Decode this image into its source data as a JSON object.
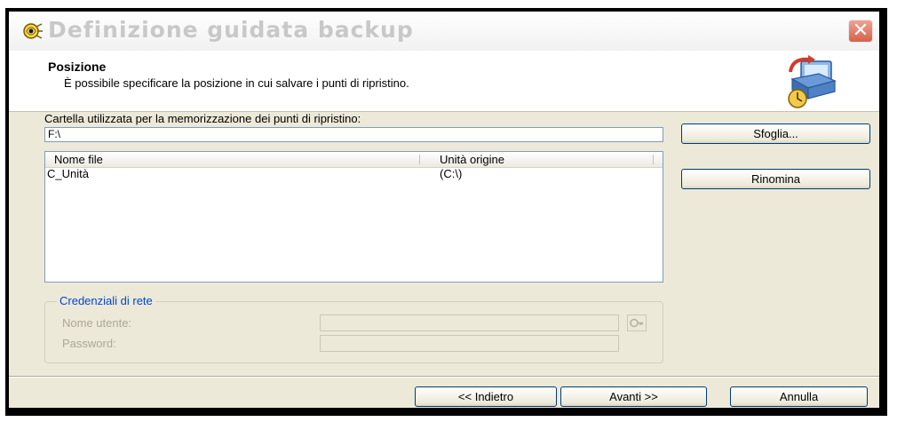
{
  "window": {
    "title": "Definizione guidata backup",
    "close_symbol": "✕",
    "title_icon": "wizard-icon"
  },
  "header": {
    "title": "Posizione",
    "description": "È possibile specificare la posizione in cui salvare i punti di ripristino.",
    "icon": "backup-restore-icon"
  },
  "location": {
    "label": "Cartella utilizzata per la memorizzazione dei punti di ripristino:",
    "value": "F:\\",
    "browse_label": "Sfoglia..."
  },
  "file_list": {
    "columns": [
      "Nome file",
      "Unità origine"
    ],
    "rows": [
      {
        "name": "C_Unità",
        "source": "(C:\\)"
      }
    ],
    "rename_label": "Rinomina"
  },
  "credentials": {
    "legend": "Credenziali di rete",
    "username_label": "Nome utente:",
    "username_value": "",
    "password_label": "Password:",
    "password_value": "",
    "lookup_icon": "key-icon"
  },
  "footer": {
    "back_label": "<< Indietro",
    "next_label": "Avanti >>",
    "cancel_label": "Annulla"
  }
}
